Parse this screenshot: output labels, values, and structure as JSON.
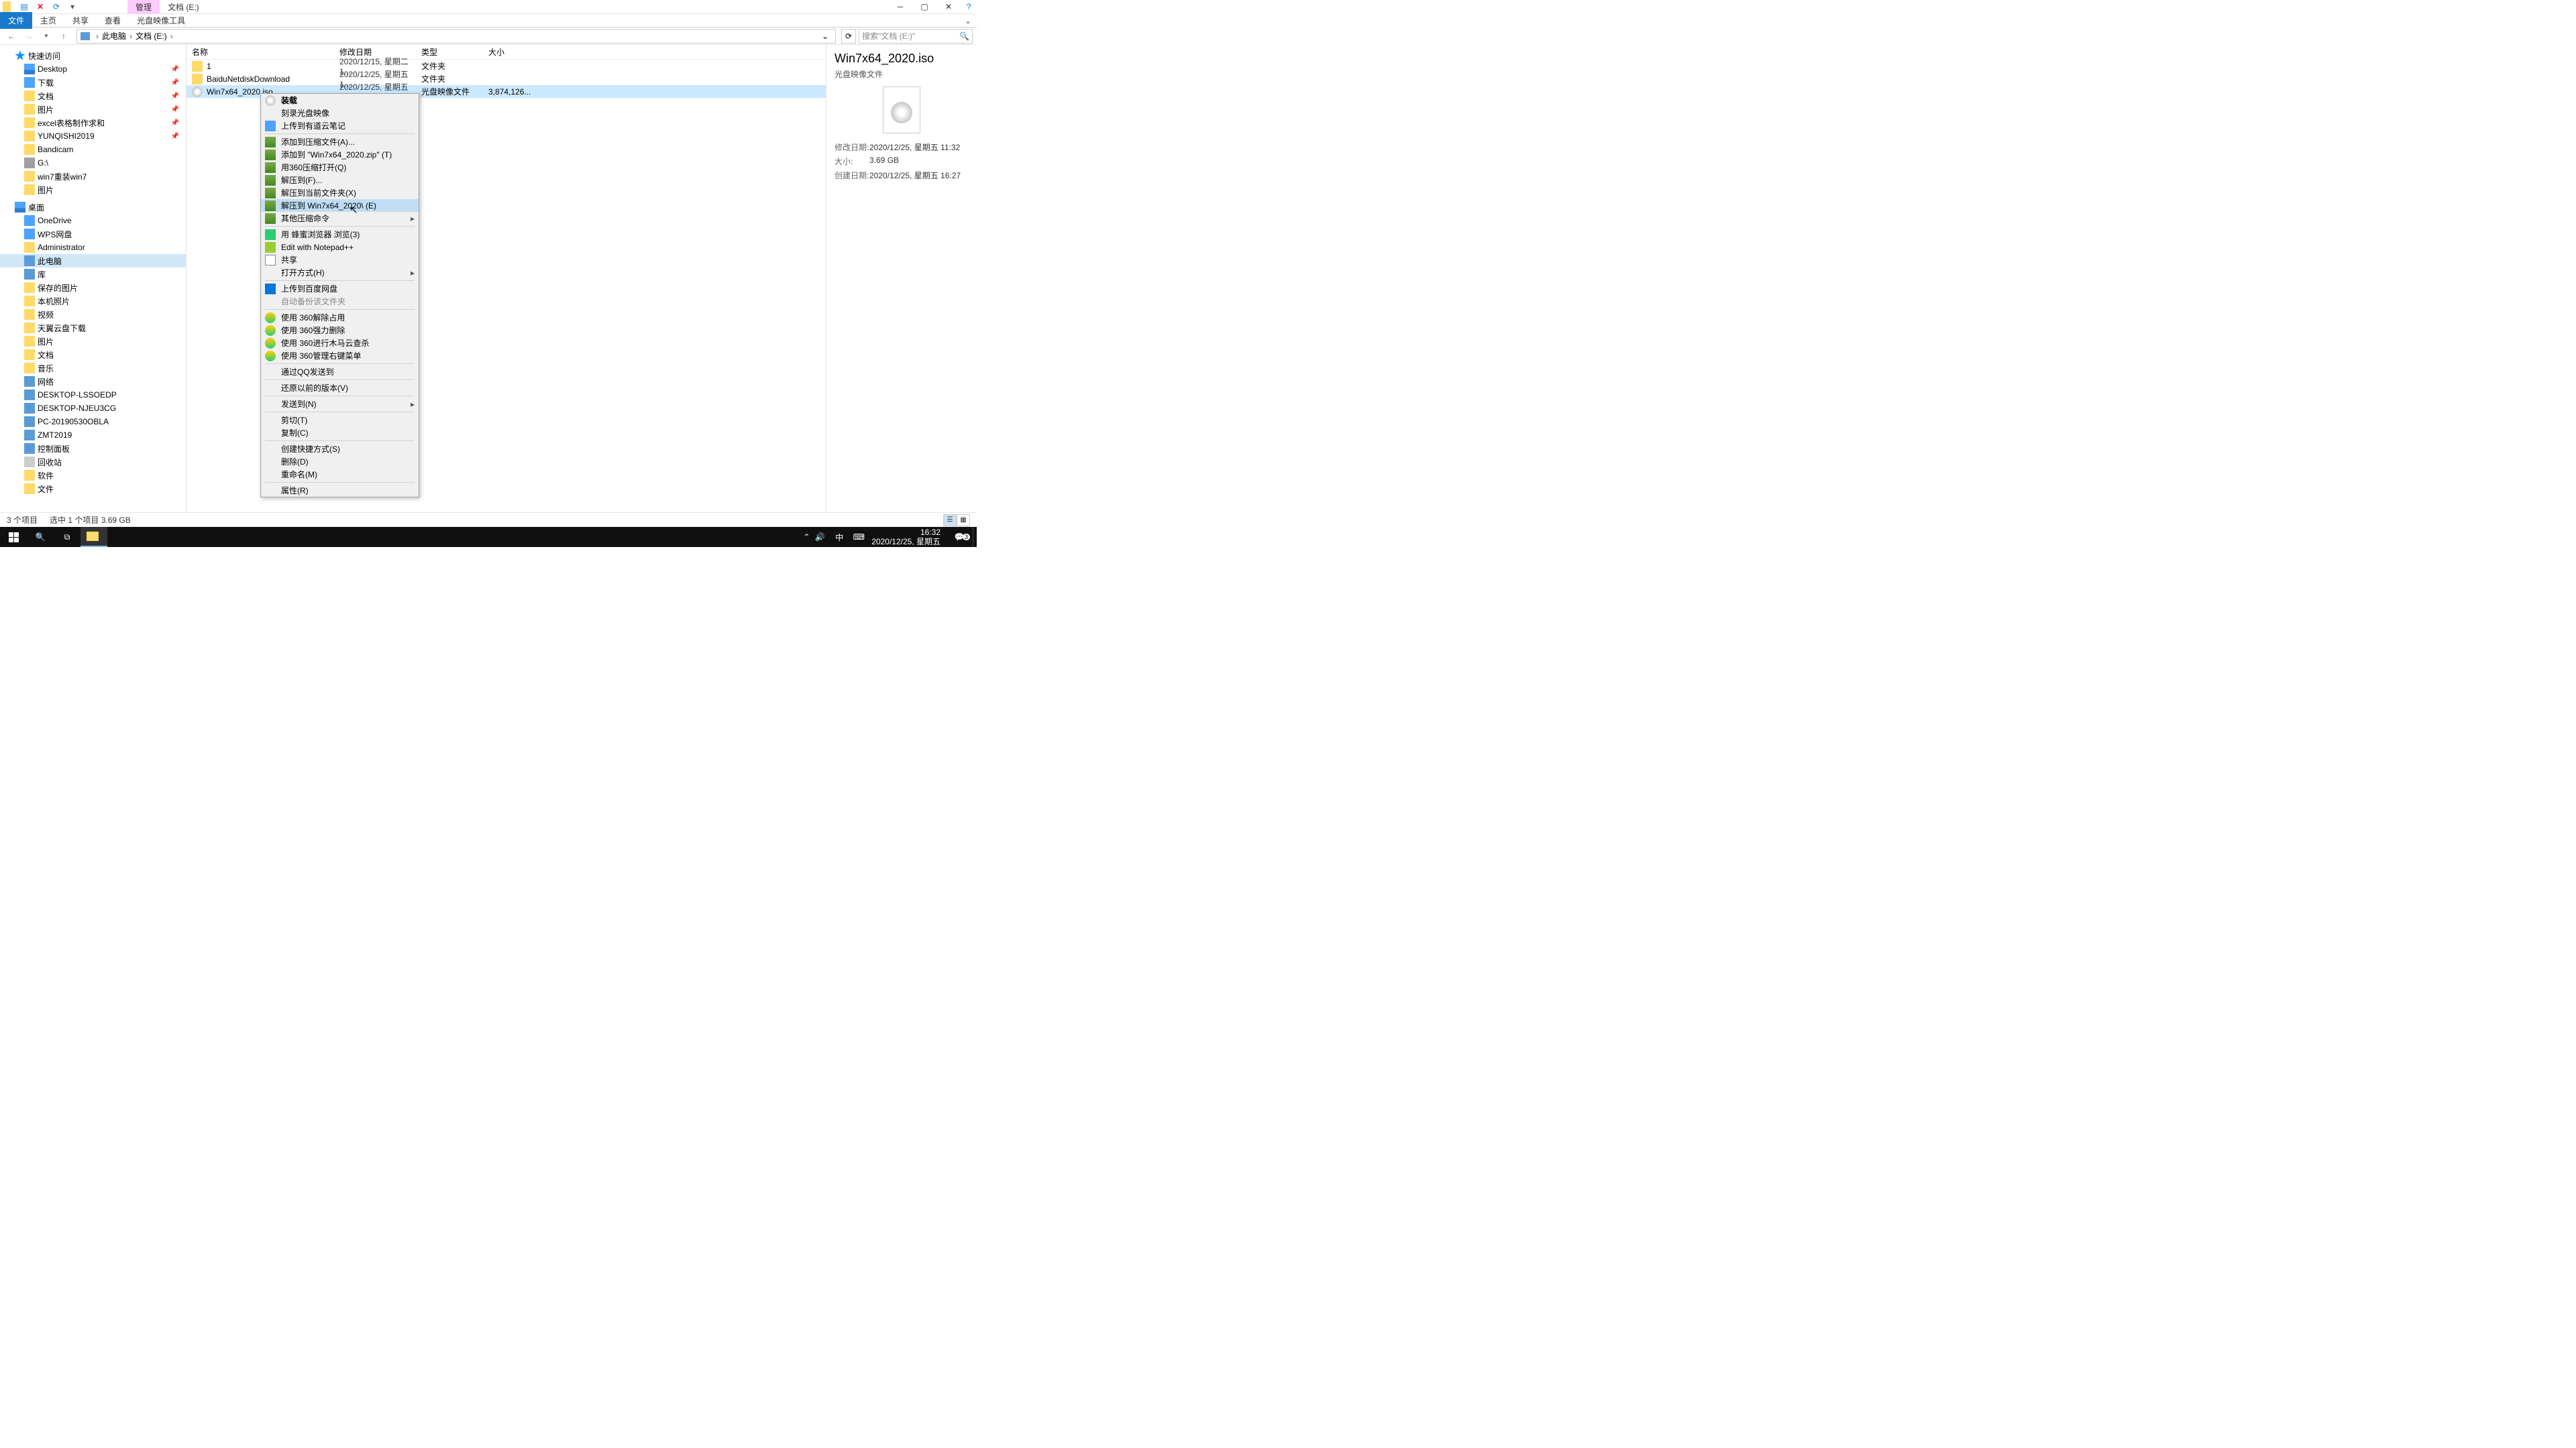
{
  "titlebar": {
    "contextTab": "管理",
    "windowTitle": "文档 (E:)"
  },
  "ribbon": {
    "file": "文件",
    "home": "主页",
    "share": "共享",
    "view": "查看",
    "discTools": "光盘映像工具"
  },
  "breadcrumb": {
    "root": "此电脑",
    "drive": "文档 (E:)"
  },
  "search": {
    "placeholder": "搜索\"文档 (E:)\""
  },
  "sidebar": {
    "quickAccess": "快速访问",
    "items1": [
      {
        "label": "Desktop",
        "pin": true
      },
      {
        "label": "下载",
        "pin": true
      },
      {
        "label": "文档",
        "pin": true
      },
      {
        "label": "图片",
        "pin": true
      },
      {
        "label": "excel表格制作求和",
        "pin": true
      },
      {
        "label": "YUNQISHI2019",
        "pin": true
      },
      {
        "label": "Bandicam"
      },
      {
        "label": "G:\\"
      },
      {
        "label": "win7重装win7"
      },
      {
        "label": "图片"
      }
    ],
    "deskSection": "桌面",
    "items2": [
      {
        "label": "OneDrive"
      },
      {
        "label": "WPS网盘"
      },
      {
        "label": "Administrator"
      },
      {
        "label": "此电脑"
      },
      {
        "label": "库"
      },
      {
        "label": "保存的图片"
      },
      {
        "label": "本机照片"
      },
      {
        "label": "视频"
      },
      {
        "label": "天翼云盘下载"
      },
      {
        "label": "图片"
      },
      {
        "label": "文档"
      },
      {
        "label": "音乐"
      },
      {
        "label": "网络"
      },
      {
        "label": "DESKTOP-LSSOEDP"
      },
      {
        "label": "DESKTOP-NJEU3CG"
      },
      {
        "label": "PC-20190530OBLA"
      },
      {
        "label": "ZMT2019"
      },
      {
        "label": "控制面板"
      },
      {
        "label": "回收站"
      },
      {
        "label": "软件"
      },
      {
        "label": "文件"
      }
    ]
  },
  "columns": {
    "name": "名称",
    "date": "修改日期",
    "type": "类型",
    "size": "大小"
  },
  "files": [
    {
      "name": "1",
      "date": "2020/12/15, 星期二 1...",
      "type": "文件夹",
      "size": ""
    },
    {
      "name": "BaiduNetdiskDownload",
      "date": "2020/12/25, 星期五 1...",
      "type": "文件夹",
      "size": ""
    },
    {
      "name": "Win7x64_2020.iso",
      "date": "2020/12/25, 星期五 1...",
      "type": "光盘映像文件",
      "size": "3,874,126..."
    }
  ],
  "details": {
    "title": "Win7x64_2020.iso",
    "type": "光盘映像文件",
    "mLabel": "修改日期:",
    "mVal": "2020/12/25, 星期五 11:32",
    "sLabel": "大小:",
    "sVal": "3.69 GB",
    "cLabel": "创建日期:",
    "cVal": "2020/12/25, 星期五 16:27"
  },
  "status": {
    "count": "3 个项目",
    "sel": "选中 1 个项目  3.69 GB"
  },
  "contextMenu": {
    "group1": [
      {
        "label": "装载",
        "bold": true,
        "icon": "disc"
      },
      {
        "label": "刻录光盘映像"
      },
      {
        "label": "上传到有道云笔记",
        "icon": "blue"
      }
    ],
    "group2": [
      {
        "label": "添加到压缩文件(A)...",
        "icon": "rar"
      },
      {
        "label": "添加到 \"Win7x64_2020.zip\" (T)",
        "icon": "rar"
      },
      {
        "label": "用360压缩打开(Q)",
        "icon": "rar"
      },
      {
        "label": "解压到(F)...",
        "icon": "rar"
      },
      {
        "label": "解压到当前文件夹(X)",
        "icon": "rar"
      },
      {
        "label": "解压到 Win7x64_2020\\ (E)",
        "icon": "rar",
        "hl": true
      },
      {
        "label": "其他压缩命令",
        "icon": "rar",
        "submenu": true
      }
    ],
    "group3": [
      {
        "label": "用 蜂蜜浏览器 浏览(3)",
        "icon": "green"
      },
      {
        "label": "Edit with Notepad++",
        "icon": "np"
      },
      {
        "label": "共享",
        "icon": "share"
      },
      {
        "label": "打开方式(H)",
        "submenu": true
      }
    ],
    "group4": [
      {
        "label": "上传到百度网盘",
        "icon": "cloud"
      },
      {
        "label": "自动备份该文件夹",
        "disabled": true
      }
    ],
    "group5": [
      {
        "label": "使用 360解除占用",
        "icon": "360"
      },
      {
        "label": "使用 360强力删除",
        "icon": "360"
      },
      {
        "label": "使用 360进行木马云查杀",
        "icon": "360"
      },
      {
        "label": "使用 360管理右键菜单",
        "icon": "360"
      }
    ],
    "group6": [
      {
        "label": "通过QQ发送到"
      }
    ],
    "group7": [
      {
        "label": "还原以前的版本(V)"
      }
    ],
    "group8": [
      {
        "label": "发送到(N)",
        "submenu": true
      }
    ],
    "group9": [
      {
        "label": "剪切(T)"
      },
      {
        "label": "复制(C)"
      }
    ],
    "group10": [
      {
        "label": "创建快捷方式(S)"
      },
      {
        "label": "删除(D)"
      },
      {
        "label": "重命名(M)"
      }
    ],
    "group11": [
      {
        "label": "属性(R)"
      }
    ]
  },
  "taskbar": {
    "ime": "中",
    "time": "16:32",
    "date": "2020/12/25, 星期五",
    "notif": "3"
  }
}
